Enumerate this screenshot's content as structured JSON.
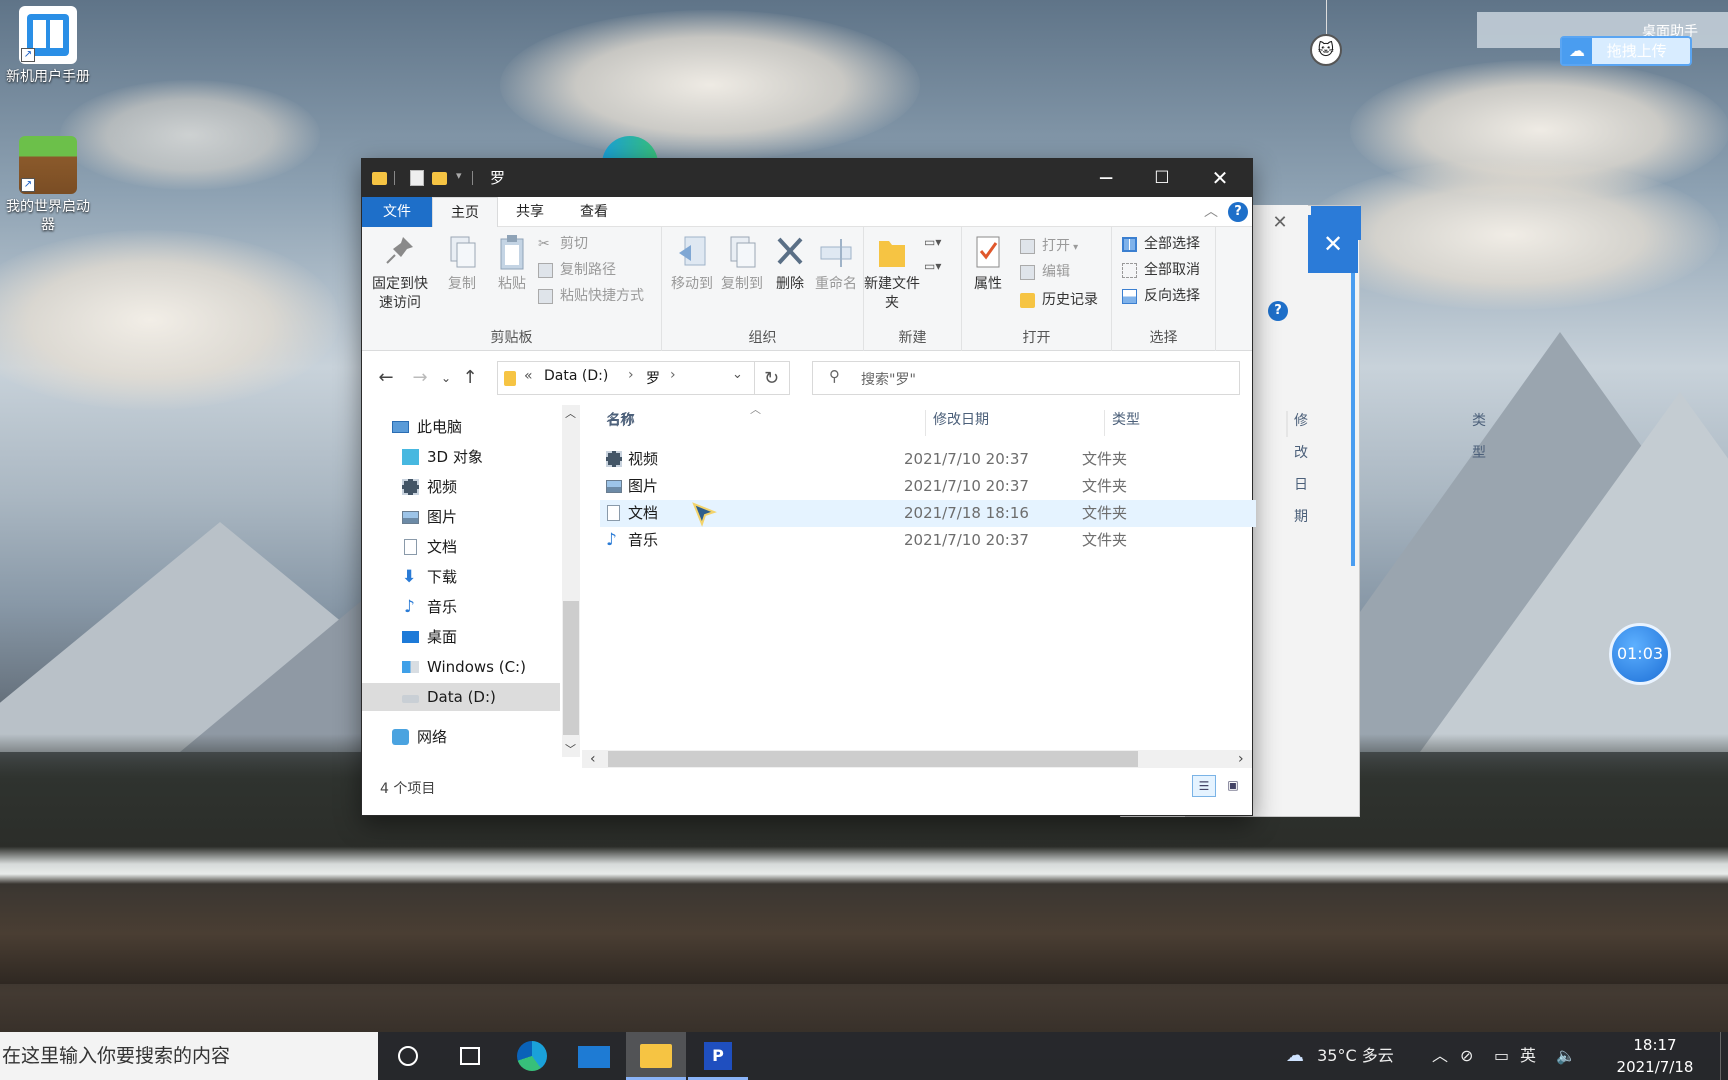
{
  "desktop": {
    "icons": [
      {
        "label": "新机用户手册"
      },
      {
        "label": "我的世界启动器"
      }
    ],
    "helper": {
      "title": "桌面助手",
      "upload_label": "拖拽上传"
    },
    "timer": "01:03"
  },
  "window": {
    "title": "罗",
    "tabs": {
      "file": "文件",
      "home": "主页",
      "share": "共享",
      "view": "查看"
    },
    "ribbon": {
      "clipboard": {
        "pin": "固定到快速访问",
        "copy": "复制",
        "paste": "粘贴",
        "cut": "剪切",
        "copy_path": "复制路径",
        "paste_shortcut": "粘贴快捷方式",
        "label": "剪贴板"
      },
      "organize": {
        "move_to": "移动到",
        "copy_to": "复制到",
        "delete": "删除",
        "rename": "重命名",
        "label": "组织"
      },
      "new": {
        "new_folder": "新建文件夹",
        "label": "新建"
      },
      "open": {
        "properties": "属性",
        "open": "打开",
        "edit": "编辑",
        "history": "历史记录",
        "label": "打开"
      },
      "select": {
        "select_all": "全部选择",
        "select_none": "全部取消",
        "invert": "反向选择",
        "label": "选择"
      }
    },
    "address": {
      "overflow": "«",
      "drive": "Data (D:)",
      "folder": "罗"
    },
    "search_placeholder": "搜索\"罗\"",
    "nav_pane": [
      {
        "label": "此电脑",
        "icon": "computer-icon"
      },
      {
        "label": "3D 对象",
        "icon": "cube-icon"
      },
      {
        "label": "视频",
        "icon": "film-icon"
      },
      {
        "label": "图片",
        "icon": "picture-icon"
      },
      {
        "label": "文档",
        "icon": "document-icon"
      },
      {
        "label": "下载",
        "icon": "download-icon"
      },
      {
        "label": "音乐",
        "icon": "music-icon"
      },
      {
        "label": "桌面",
        "icon": "desktop-icon"
      },
      {
        "label": "Windows (C:)",
        "icon": "windows-drive-icon"
      },
      {
        "label": "Data (D:)",
        "icon": "drive-icon"
      },
      {
        "label": "网络",
        "icon": "network-icon"
      }
    ],
    "columns": {
      "name": "名称",
      "date": "修改日期",
      "type": "类型"
    },
    "files": [
      {
        "name": "视频",
        "date": "2021/7/10 20:37",
        "type": "文件夹",
        "icon": "film-icon"
      },
      {
        "name": "图片",
        "date": "2021/7/10 20:37",
        "type": "文件夹",
        "icon": "picture-icon"
      },
      {
        "name": "文档",
        "date": "2021/7/18 18:16",
        "type": "文件夹",
        "icon": "document-icon"
      },
      {
        "name": "音乐",
        "date": "2021/7/10 20:37",
        "type": "文件夹",
        "icon": "music-icon"
      }
    ],
    "status": "4 个项目"
  },
  "taskbar": {
    "search_placeholder": "在这里输入你要搜索的内容",
    "weather": "35°C 多云",
    "time": "18:17",
    "date": "2021/7/18"
  },
  "colors": {
    "accent": "#1e6fc9",
    "titlebar": "#2b2b2b",
    "selection": "#e5f3ff",
    "folder": "#f6c443"
  }
}
